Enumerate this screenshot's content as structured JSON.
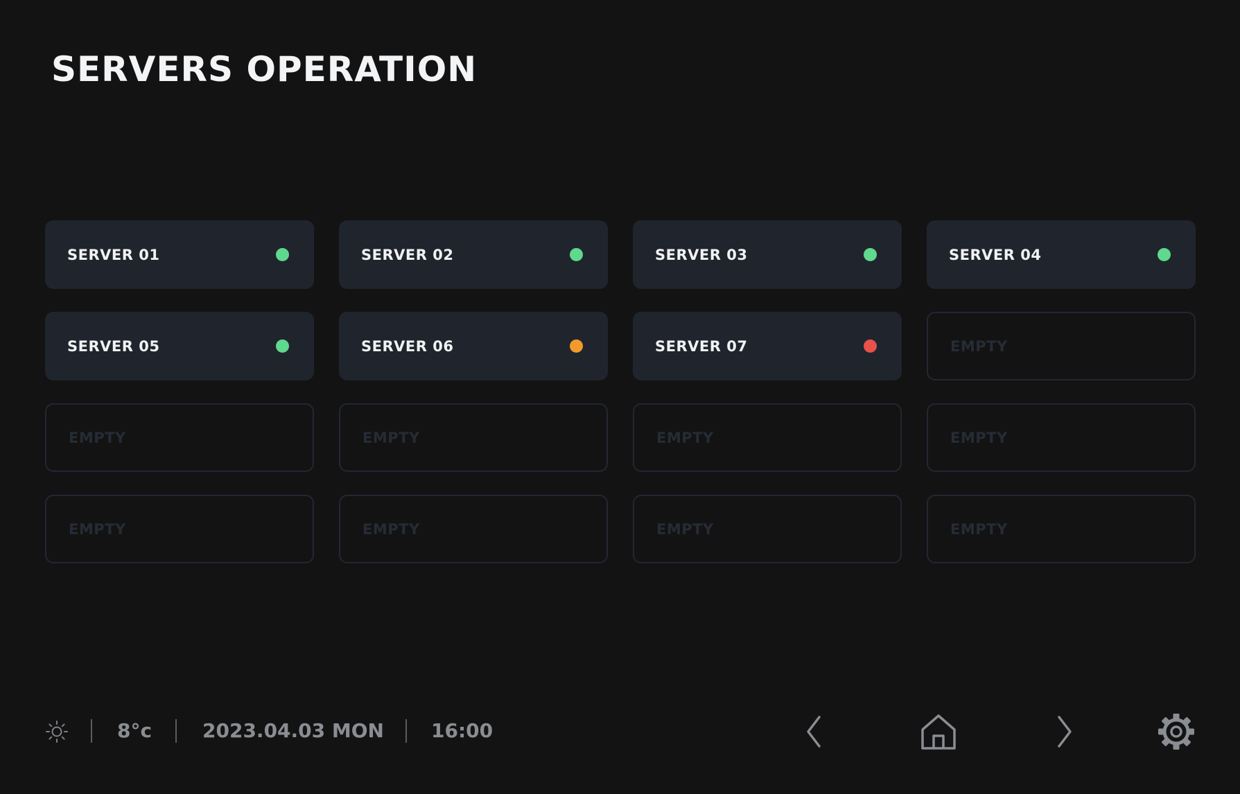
{
  "header": {
    "title": "SERVERS OPERATION"
  },
  "colors": {
    "status_ok": "#5fd98d",
    "status_warning": "#f39a2b",
    "status_error": "#e8524a"
  },
  "servers": [
    {
      "label": "SERVER 01",
      "status": "ok",
      "status_color": "#5fd98d"
    },
    {
      "label": "SERVER 02",
      "status": "ok",
      "status_color": "#5fd98d"
    },
    {
      "label": "SERVER 03",
      "status": "ok",
      "status_color": "#5fd98d"
    },
    {
      "label": "SERVER 04",
      "status": "ok",
      "status_color": "#5fd98d"
    },
    {
      "label": "SERVER 05",
      "status": "ok",
      "status_color": "#5fd98d"
    },
    {
      "label": "SERVER 06",
      "status": "warning",
      "status_color": "#f39a2b"
    },
    {
      "label": "SERVER 07",
      "status": "error",
      "status_color": "#e8524a"
    },
    {
      "label": "EMPTY",
      "status": "empty"
    },
    {
      "label": "EMPTY",
      "status": "empty"
    },
    {
      "label": "EMPTY",
      "status": "empty"
    },
    {
      "label": "EMPTY",
      "status": "empty"
    },
    {
      "label": "EMPTY",
      "status": "empty"
    },
    {
      "label": "EMPTY",
      "status": "empty"
    },
    {
      "label": "EMPTY",
      "status": "empty"
    },
    {
      "label": "EMPTY",
      "status": "empty"
    },
    {
      "label": "EMPTY",
      "status": "empty"
    }
  ],
  "footer": {
    "weather_icon": "sun-icon",
    "temperature": "8°c",
    "date": "2023.04.03 MON",
    "time": "16:00",
    "nav": {
      "prev_icon": "chevron-left-icon",
      "home_icon": "home-icon",
      "next_icon": "chevron-right-icon",
      "settings_icon": "gear-icon"
    }
  }
}
